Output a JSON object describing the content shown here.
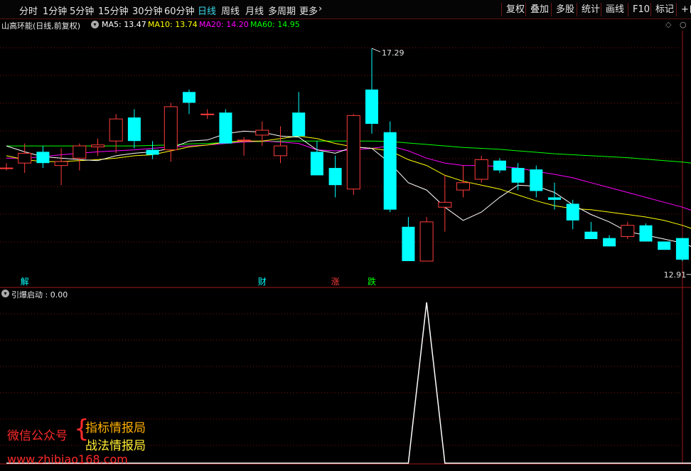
{
  "toolbar": {
    "periods": [
      {
        "label": "分时",
        "active": false
      },
      {
        "label": "1分钟",
        "active": false
      },
      {
        "label": "5分钟",
        "active": false
      },
      {
        "label": "15分钟",
        "active": false
      },
      {
        "label": "30分钟",
        "active": false
      },
      {
        "label": "60分钟",
        "active": false
      },
      {
        "label": "日线",
        "active": true
      },
      {
        "label": "周线",
        "active": false
      },
      {
        "label": "月线",
        "active": false
      },
      {
        "label": "多周期",
        "active": false
      },
      {
        "label": "更多",
        "active": false
      }
    ],
    "actions": [
      "复权",
      "叠加",
      "多股",
      "统计",
      "画线",
      "F10",
      "标记",
      "+自"
    ]
  },
  "info": {
    "title": "山高环能(日线,前复权)",
    "ma5": "MA5: 13.47",
    "ma10": "MA10: 13.74",
    "ma20": "MA20: 14.20",
    "ma60": "MA60: 14.95"
  },
  "colors": {
    "up": "#ff3b3b",
    "down": "#00ffff",
    "ma5": "#ffffff",
    "ma10": "#ffff00",
    "ma20": "#ff00ff",
    "ma60": "#00ff00",
    "grid": "#7a1010",
    "tb_active": "#3cd8e8"
  },
  "chart_data": [
    {
      "type": "candlestick",
      "high_label": "17.29",
      "low_label": "12.91",
      "ohlc": [
        {
          "o": 14.85,
          "h": 14.95,
          "l": 14.8,
          "c": 14.85
        },
        {
          "o": 14.95,
          "h": 15.35,
          "l": 14.75,
          "c": 15.15
        },
        {
          "o": 15.18,
          "h": 15.3,
          "l": 14.85,
          "c": 14.95
        },
        {
          "o": 14.9,
          "h": 15.25,
          "l": 14.5,
          "c": 14.98
        },
        {
          "o": 15.05,
          "h": 15.35,
          "l": 14.8,
          "c": 15.3
        },
        {
          "o": 15.28,
          "h": 15.45,
          "l": 15.1,
          "c": 15.32
        },
        {
          "o": 15.4,
          "h": 15.95,
          "l": 15.15,
          "c": 15.85
        },
        {
          "o": 15.88,
          "h": 16.05,
          "l": 15.25,
          "c": 15.4
        },
        {
          "o": 15.22,
          "h": 15.4,
          "l": 15.03,
          "c": 15.12
        },
        {
          "o": 15.22,
          "h": 16.18,
          "l": 14.98,
          "c": 16.1
        },
        {
          "o": 16.4,
          "h": 16.45,
          "l": 15.95,
          "c": 16.18
        },
        {
          "o": 15.95,
          "h": 16.05,
          "l": 15.85,
          "c": 15.95
        },
        {
          "o": 15.98,
          "h": 16.05,
          "l": 15.35,
          "c": 15.35
        },
        {
          "o": 15.42,
          "h": 15.48,
          "l": 15.1,
          "c": 15.42
        },
        {
          "o": 15.52,
          "h": 15.8,
          "l": 15.3,
          "c": 15.62
        },
        {
          "o": 15.1,
          "h": 15.7,
          "l": 14.95,
          "c": 15.3
        },
        {
          "o": 15.98,
          "h": 16.4,
          "l": 15.48,
          "c": 15.5
        },
        {
          "o": 15.18,
          "h": 15.4,
          "l": 14.75,
          "c": 14.7
        },
        {
          "o": 14.85,
          "h": 15.1,
          "l": 14.25,
          "c": 14.5
        },
        {
          "o": 14.42,
          "h": 15.95,
          "l": 14.3,
          "c": 15.92
        },
        {
          "o": 16.45,
          "h": 17.29,
          "l": 15.55,
          "c": 15.75
        },
        {
          "o": 15.58,
          "h": 15.8,
          "l": 13.95,
          "c": 14.0
        },
        {
          "o": 13.65,
          "h": 13.85,
          "l": 12.95,
          "c": 12.95
        },
        {
          "o": 12.95,
          "h": 13.85,
          "l": 12.95,
          "c": 13.75
        },
        {
          "o": 14.05,
          "h": 14.7,
          "l": 13.55,
          "c": 14.15
        },
        {
          "o": 14.4,
          "h": 14.9,
          "l": 14.25,
          "c": 14.55
        },
        {
          "o": 14.62,
          "h": 15.1,
          "l": 14.55,
          "c": 15.02
        },
        {
          "o": 15.0,
          "h": 15.05,
          "l": 14.75,
          "c": 14.8
        },
        {
          "o": 14.85,
          "h": 14.95,
          "l": 14.4,
          "c": 14.55
        },
        {
          "o": 14.82,
          "h": 14.9,
          "l": 14.25,
          "c": 14.38
        },
        {
          "o": 14.25,
          "h": 14.55,
          "l": 14.0,
          "c": 14.2
        },
        {
          "o": 14.12,
          "h": 14.2,
          "l": 13.6,
          "c": 13.78
        },
        {
          "o": 13.55,
          "h": 13.75,
          "l": 13.4,
          "c": 13.4
        },
        {
          "o": 13.42,
          "h": 13.48,
          "l": 13.25,
          "c": 13.25
        },
        {
          "o": 13.45,
          "h": 13.75,
          "l": 13.4,
          "c": 13.68
        },
        {
          "o": 13.68,
          "h": 13.72,
          "l": 13.35,
          "c": 13.35
        },
        {
          "o": 13.35,
          "h": 13.35,
          "l": 13.2,
          "c": 13.18
        },
        {
          "o": 13.42,
          "h": 13.42,
          "l": 12.95,
          "c": 12.98
        },
        {
          "o": 12.98,
          "h": 13.2,
          "l": 12.91,
          "c": 12.91
        }
      ],
      "ma5": [
        15.3,
        15.18,
        15.08,
        15.05,
        15.02,
        15.0,
        15.1,
        15.15,
        15.18,
        15.25,
        15.4,
        15.42,
        15.55,
        15.6,
        15.58,
        15.5,
        15.48,
        15.22,
        15.15,
        15.28,
        15.25,
        14.95,
        14.55,
        14.4,
        14.05,
        13.78,
        13.95,
        14.25,
        14.5,
        14.48,
        14.35,
        14.1,
        13.9,
        13.75,
        13.55,
        13.48,
        13.4,
        13.32,
        13.17
      ],
      "ma10": [
        15.1,
        15.02,
        14.98,
        14.98,
        15.0,
        15.02,
        15.05,
        15.1,
        15.12,
        15.2,
        15.28,
        15.32,
        15.38,
        15.4,
        15.4,
        15.45,
        15.5,
        15.45,
        15.35,
        15.28,
        15.25,
        15.2,
        15.02,
        14.9,
        14.7,
        14.58,
        14.5,
        14.42,
        14.3,
        14.18,
        14.08,
        14.02,
        14.0,
        13.95,
        13.9,
        13.85,
        13.78,
        13.68,
        13.55
      ],
      "ma20": [
        15.05,
        15.05,
        15.08,
        15.12,
        15.15,
        15.18,
        15.2,
        15.22,
        15.25,
        15.28,
        15.3,
        15.32,
        15.35,
        15.38,
        15.4,
        15.38,
        15.35,
        15.22,
        15.2,
        15.22,
        15.25,
        15.3,
        15.2,
        15.05,
        14.95,
        14.9,
        14.9,
        14.88,
        14.85,
        14.78,
        14.72,
        14.65,
        14.55,
        14.45,
        14.35,
        14.25,
        14.15,
        14.05,
        13.92
      ],
      "ma60": [
        15.3,
        15.3,
        15.3,
        15.3,
        15.3,
        15.3,
        15.3,
        15.3,
        15.31,
        15.32,
        15.34,
        15.35,
        15.37,
        15.38,
        15.39,
        15.4,
        15.4,
        15.4,
        15.4,
        15.4,
        15.4,
        15.39,
        15.36,
        15.33,
        15.3,
        15.27,
        15.25,
        15.23,
        15.2,
        15.17,
        15.14,
        15.12,
        15.1,
        15.08,
        15.06,
        15.03,
        15.0,
        14.97,
        14.93
      ],
      "event_markers": [
        {
          "index": 1,
          "label": "解",
          "color": "#00ffff"
        },
        {
          "index": 14,
          "label": "财",
          "color": "#00ffff"
        },
        {
          "index": 18,
          "label": "涨",
          "color": "#ff3b3b"
        },
        {
          "index": 20,
          "label": "跌",
          "color": "#00ff00"
        }
      ]
    },
    {
      "type": "line",
      "name": "引爆启动",
      "readout": "引爆启动 : 0.00",
      "values": [
        0,
        0,
        0,
        0,
        0,
        0,
        0,
        0,
        0,
        0,
        0,
        0,
        0,
        0,
        0,
        0,
        0,
        0,
        0,
        0,
        0,
        0,
        0,
        1,
        0,
        0,
        0,
        0,
        0,
        0,
        0,
        0,
        0,
        0,
        0,
        0,
        0,
        0,
        0
      ]
    }
  ],
  "watermark": {
    "line1": "微信公众号",
    "line2a": "指标情报局",
    "line2b": "战法情报局",
    "url": "www.zhibiao168.com"
  }
}
